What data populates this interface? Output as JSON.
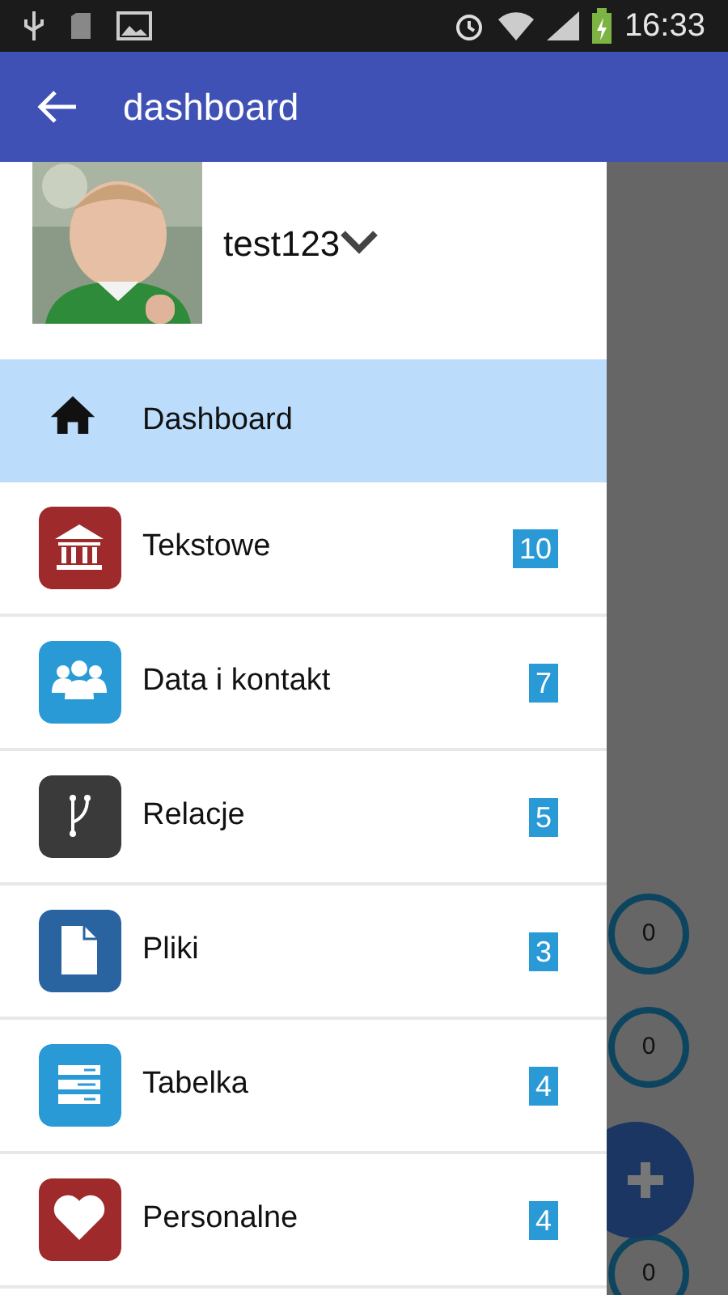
{
  "status_bar": {
    "time": "16:33"
  },
  "app_bar": {
    "title": "dashboard"
  },
  "profile": {
    "name": "test123",
    "expanded": false
  },
  "menu": [
    {
      "label": "Dashboard",
      "selected": true
    },
    {
      "label": "Tekstowe",
      "color": "#9e2a2b",
      "count": "10",
      "selected": false
    },
    {
      "label": "Data i kontakt",
      "color": "#2a9ad6",
      "count": "7",
      "selected": false
    },
    {
      "label": "Relacje",
      "color": "#3a3a3a",
      "count": "5",
      "selected": false
    },
    {
      "label": "Pliki",
      "color": "#2a64a0",
      "count": "3",
      "selected": false
    },
    {
      "label": "Tabelka",
      "color": "#2a9ad6",
      "count": "4",
      "selected": false
    },
    {
      "label": "Personalne",
      "color": "#9e2a2b",
      "count": "4",
      "selected": false
    }
  ],
  "background_counters": [
    {
      "value": "0"
    },
    {
      "value": "0"
    },
    {
      "value": "0"
    }
  ]
}
